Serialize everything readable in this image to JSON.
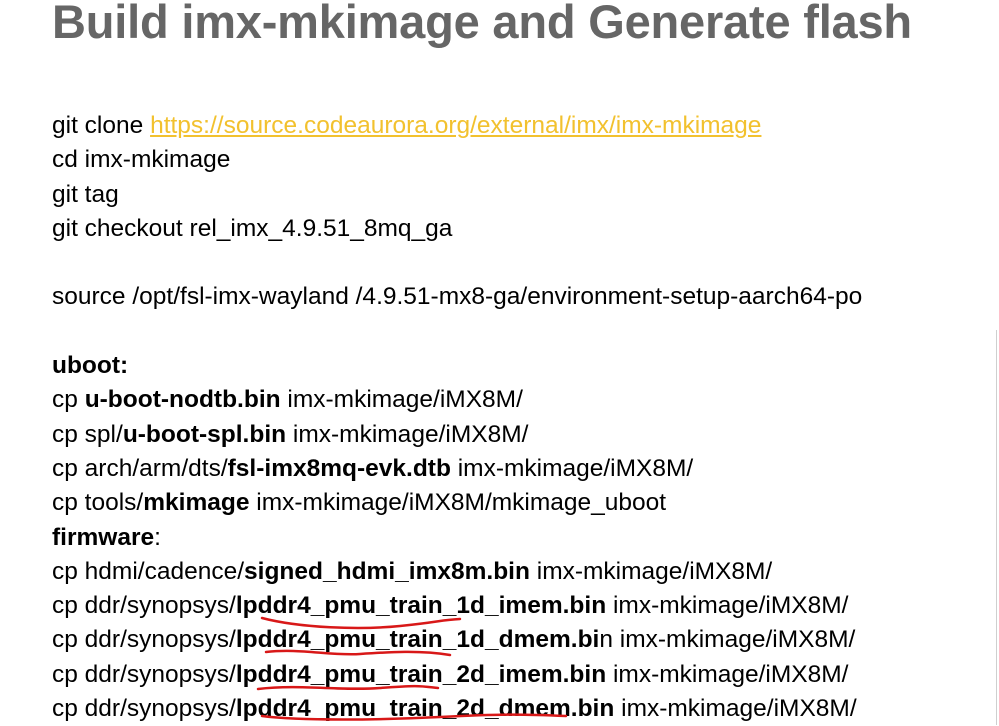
{
  "title": "Build imx-mkimage and Generate flash",
  "setup": {
    "clone_prefix": "git clone ",
    "clone_url": "https://source.codeaurora.org/external/imx/imx-mkimage",
    "cd": "cd imx-mkimage",
    "tag": "git tag",
    "checkout": "git checkout rel_imx_4.9.51_8mq_ga",
    "source": "source  /opt/fsl-imx-wayland /4.9.51-mx8-ga/environment-setup-aarch64-po"
  },
  "uboot": {
    "heading": "uboot:",
    "l1": {
      "a": "cp ",
      "b": "u-boot-nodtb.bin",
      "c": " imx-mkimage/iMX8M/"
    },
    "l2": {
      "a": "cp spl/",
      "b": "u-boot-spl.bin",
      "c": "  imx-mkimage/iMX8M/"
    },
    "l3": {
      "a": "cp arch/arm/dts/",
      "b": "fsl-imx8mq-evk.dtb",
      "c": "  imx-mkimage/iMX8M/"
    },
    "l4": {
      "a": "cp  tools/",
      "b": "mkimage",
      "c": "  imx-mkimage/iMX8M/mkimage_uboot"
    }
  },
  "firmware": {
    "heading": "firmware",
    "heading_suffix": ":",
    "l1": {
      "a": "cp hdmi/cadence/",
      "b": "signed_hdmi_imx8m.bin",
      "c": "  imx-mkimage/iMX8M/"
    },
    "l2": {
      "a": "cp ddr/synopsys/",
      "b": "lpddr4_pmu_train_1d_imem.bin",
      "c": " imx-mkimage/iMX8M/"
    },
    "l3": {
      "a": "cp ddr/synopsys/",
      "b": "lpddr4_pmu_train_1d_dmem.bi",
      "c": "n imx-mkimage/iMX8M/"
    },
    "l4": {
      "a": "cp ddr/synopsys/",
      "b": "lpddr4_pmu_train_2d_imem.bin",
      "c": " imx-mkimage/iMX8M/"
    },
    "l5": {
      "a": "cp ddr/synopsys/",
      "b": "lpddr4_pmu_train_2d_dmem.bin",
      "c": " imx-mkimage/iMX8M/"
    }
  },
  "colors": {
    "title": "#666666",
    "link": "#f2c12e",
    "annotation": "#d81818"
  }
}
